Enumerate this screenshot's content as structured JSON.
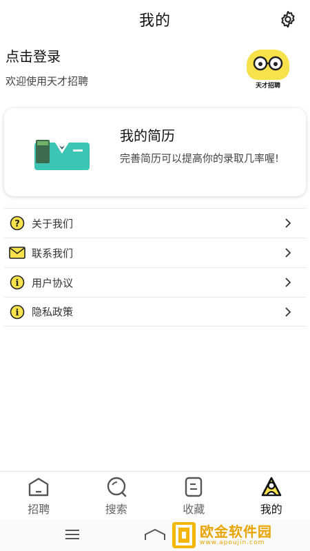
{
  "header": {
    "title": "我的",
    "settings_icon": "gear-icon"
  },
  "login": {
    "title": "点击登录",
    "subtitle": "欢迎使用天才招聘"
  },
  "logo": {
    "text": "天才招聘"
  },
  "resume_card": {
    "title": "我的简历",
    "description": "完善简历可以提高你的录取几率喔!"
  },
  "menu": {
    "items": [
      {
        "label": "关于我们",
        "icon": "question-icon"
      },
      {
        "label": "联系我们",
        "icon": "mail-icon"
      },
      {
        "label": "用户协议",
        "icon": "info-icon"
      },
      {
        "label": "隐私政策",
        "icon": "info-icon"
      }
    ]
  },
  "tabbar": {
    "items": [
      {
        "label": "招聘",
        "icon": "home-icon"
      },
      {
        "label": "搜索",
        "icon": "search-icon"
      },
      {
        "label": "收藏",
        "icon": "document-icon"
      },
      {
        "label": "我的",
        "icon": "user-icon",
        "active": true
      }
    ]
  },
  "watermark": {
    "title": "欧金软件园",
    "url": "www.apoujin.com"
  },
  "colors": {
    "accent": "#f7e24c",
    "text": "#111111",
    "watermark": "#e8a400"
  }
}
